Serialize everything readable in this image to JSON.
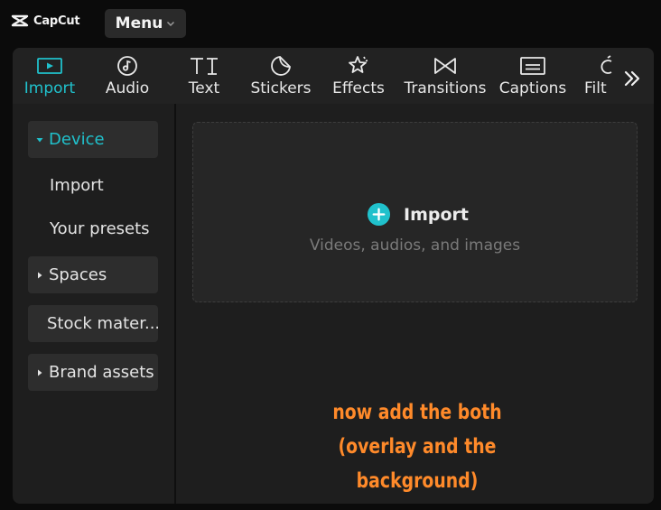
{
  "app": {
    "name": "CapCut"
  },
  "menu": {
    "label": "Menu"
  },
  "toolbar": {
    "tabs": [
      {
        "label": "Import",
        "icon": "import-icon",
        "active": true
      },
      {
        "label": "Audio",
        "icon": "audio-icon"
      },
      {
        "label": "Text",
        "icon": "text-icon"
      },
      {
        "label": "Stickers",
        "icon": "stickers-icon"
      },
      {
        "label": "Effects",
        "icon": "effects-icon"
      },
      {
        "label": "Transitions",
        "icon": "transitions-icon"
      },
      {
        "label": "Captions",
        "icon": "captions-icon"
      },
      {
        "label": "Filt",
        "icon": "filters-icon"
      }
    ],
    "more_icon": "double-chevron-right-icon"
  },
  "sidebar": {
    "device": "Device",
    "import": "Import",
    "presets": "Your presets",
    "spaces": "Spaces",
    "stock": "Stock mater...",
    "brand": "Brand assets"
  },
  "dropzone": {
    "title": "Import",
    "subtitle": "Videos, audios, and images"
  },
  "annotation": {
    "line1": "now add the both",
    "line2": "(overlay and the",
    "line3": "background)"
  },
  "colors": {
    "accent": "#20c1cc",
    "annotation": "#ff8a2a",
    "panel": "#1e1e1e"
  }
}
